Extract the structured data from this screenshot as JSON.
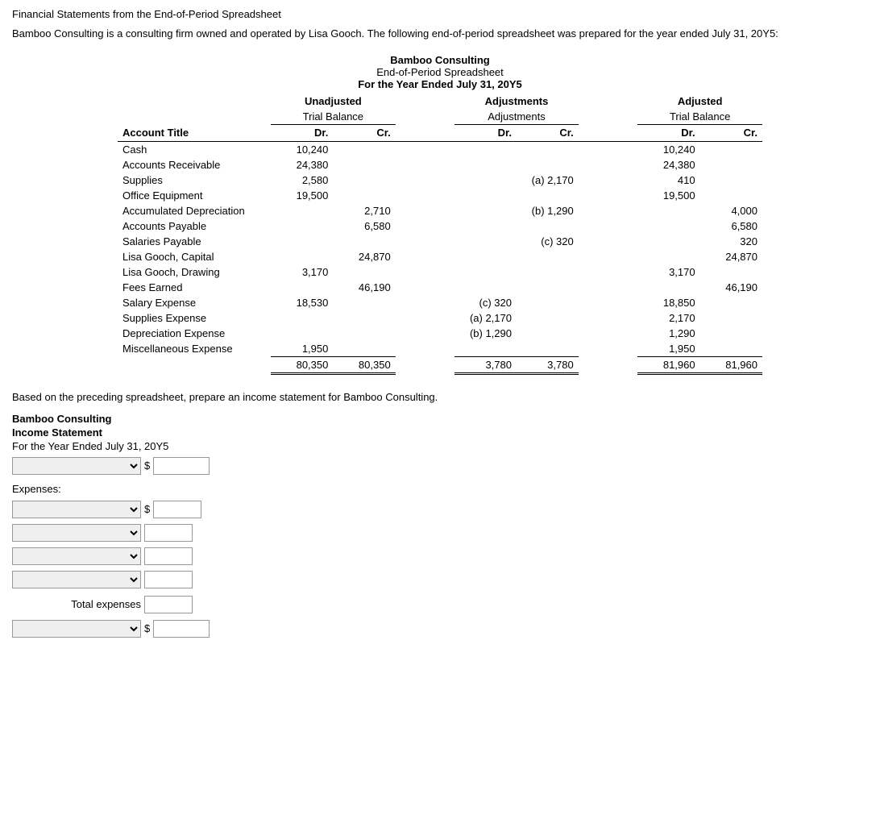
{
  "page": {
    "header": "Financial Statements from the End-of-Period Spreadsheet",
    "intro": "Bamboo Consulting is a consulting firm owned and operated by Lisa Gooch. The following end-of-period spreadsheet was prepared for the year ended July 31, 20Y5:"
  },
  "spreadsheet": {
    "company": "Bamboo Consulting",
    "title": "End-of-Period Spreadsheet",
    "period": "For the Year Ended July 31, 20Y5",
    "col_headers": {
      "unadjusted": "Unadjusted",
      "trial_balance": "Trial Balance",
      "adjustments": "Adjustments",
      "adjusted": "Adjusted",
      "adjusted_tb": "Trial Balance",
      "dr": "Dr.",
      "cr": "Cr."
    },
    "accounts": [
      {
        "name": "Cash",
        "utb_dr": "10,240",
        "utb_cr": "",
        "adj_dr": "",
        "adj_cr": "",
        "atb_dr": "10,240",
        "atb_cr": ""
      },
      {
        "name": "Accounts Receivable",
        "utb_dr": "24,380",
        "utb_cr": "",
        "adj_dr": "",
        "adj_cr": "",
        "atb_dr": "24,380",
        "atb_cr": ""
      },
      {
        "name": "Supplies",
        "utb_dr": "2,580",
        "utb_cr": "",
        "adj_dr": "",
        "adj_cr": "(a) 2,170",
        "atb_dr": "410",
        "atb_cr": ""
      },
      {
        "name": "Office Equipment",
        "utb_dr": "19,500",
        "utb_cr": "",
        "adj_dr": "",
        "adj_cr": "",
        "atb_dr": "19,500",
        "atb_cr": ""
      },
      {
        "name": "Accumulated Depreciation",
        "utb_dr": "",
        "utb_cr": "2,710",
        "adj_dr": "",
        "adj_cr": "(b) 1,290",
        "atb_dr": "",
        "atb_cr": "4,000"
      },
      {
        "name": "Accounts Payable",
        "utb_dr": "",
        "utb_cr": "6,580",
        "adj_dr": "",
        "adj_cr": "",
        "atb_dr": "",
        "atb_cr": "6,580"
      },
      {
        "name": "Salaries Payable",
        "utb_dr": "",
        "utb_cr": "",
        "adj_dr": "",
        "adj_cr": "(c) 320",
        "atb_dr": "",
        "atb_cr": "320"
      },
      {
        "name": "Lisa Gooch, Capital",
        "utb_dr": "",
        "utb_cr": "24,870",
        "adj_dr": "",
        "adj_cr": "",
        "atb_dr": "",
        "atb_cr": "24,870"
      },
      {
        "name": "Lisa Gooch, Drawing",
        "utb_dr": "3,170",
        "utb_cr": "",
        "adj_dr": "",
        "adj_cr": "",
        "atb_dr": "3,170",
        "atb_cr": ""
      },
      {
        "name": "Fees Earned",
        "utb_dr": "",
        "utb_cr": "46,190",
        "adj_dr": "",
        "adj_cr": "",
        "atb_dr": "",
        "atb_cr": "46,190"
      },
      {
        "name": "Salary Expense",
        "utb_dr": "18,530",
        "utb_cr": "",
        "adj_dr": "(c) 320",
        "adj_cr": "",
        "atb_dr": "18,850",
        "atb_cr": ""
      },
      {
        "name": "Supplies Expense",
        "utb_dr": "",
        "utb_cr": "",
        "adj_dr": "(a) 2,170",
        "adj_cr": "",
        "atb_dr": "2,170",
        "atb_cr": ""
      },
      {
        "name": "Depreciation Expense",
        "utb_dr": "",
        "utb_cr": "",
        "adj_dr": "(b) 1,290",
        "adj_cr": "",
        "atb_dr": "1,290",
        "atb_cr": ""
      },
      {
        "name": "Miscellaneous Expense",
        "utb_dr": "1,950",
        "utb_cr": "",
        "adj_dr": "",
        "adj_cr": "",
        "atb_dr": "1,950",
        "atb_cr": ""
      }
    ],
    "totals": {
      "utb_dr": "80,350",
      "utb_cr": "80,350",
      "adj_dr": "3,780",
      "adj_cr": "3,780",
      "atb_dr": "81,960",
      "atb_cr": "81,960"
    }
  },
  "income_statement": {
    "based_on_text": "Based on the preceding spreadsheet, prepare an income statement for Bamboo Consulting.",
    "company": "Bamboo Consulting",
    "title": "Income Statement",
    "period": "For the Year Ended July 31, 20Y5",
    "revenue_dropdown_placeholder": "",
    "expenses_label": "Expenses:",
    "total_expenses_label": "Total expenses",
    "expense_rows": 4,
    "dollar_sign": "$"
  }
}
